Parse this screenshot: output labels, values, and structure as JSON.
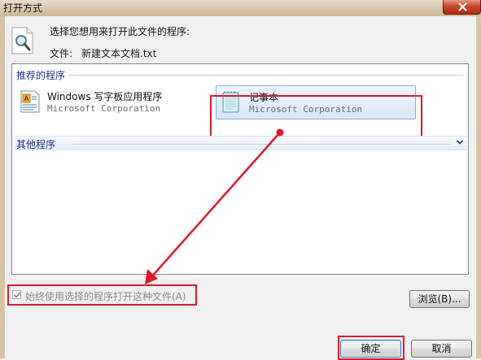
{
  "window": {
    "title": "打开方式"
  },
  "header": {
    "prompt": "选择您想用来打开此文件的程序:",
    "file_label": "文件:",
    "file_name": "新建文本文档.txt"
  },
  "list": {
    "recommended_header": "推荐的程序",
    "other_header": "其他程序",
    "programs": [
      {
        "name": "Windows 写字板应用程序",
        "company": "Microsoft Corporation",
        "icon": "wordpad-icon",
        "selected": false
      },
      {
        "name": "记事本",
        "company": "Microsoft Corporation",
        "icon": "notepad-icon",
        "selected": true
      }
    ]
  },
  "options": {
    "always_use_label": "始终使用选择的程序打开这种文件(A)",
    "always_use_checked": true,
    "always_use_enabled": false
  },
  "buttons": {
    "browse": "浏览(B)...",
    "ok": "确定",
    "cancel": "取消"
  },
  "colors": {
    "highlight": "#e0182b",
    "group_text": "#1e3287",
    "selection_border": "#84acdd"
  }
}
